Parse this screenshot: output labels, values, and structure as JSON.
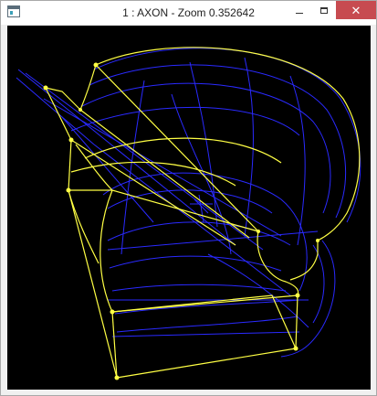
{
  "window": {
    "title": "1 : AXON - Zoom 0.352642",
    "close_glyph": "✕"
  },
  "icons": {
    "app": "app-window-icon",
    "minimize": "minimize-icon",
    "maximize": "maximize-icon",
    "close": "close-icon"
  },
  "colors": {
    "viewport_background": "#000000",
    "wire_blue": "#2a2aff",
    "wire_yellow": "#ffff44",
    "close_button": "#c74b50"
  }
}
